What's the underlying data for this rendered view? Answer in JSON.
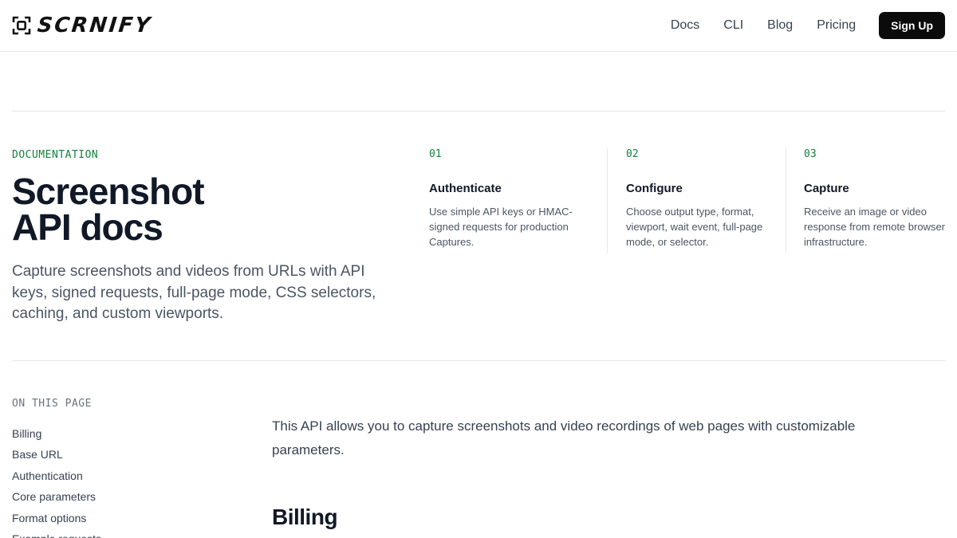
{
  "brand": {
    "name": "SCRNIFY"
  },
  "nav": {
    "links": [
      "Docs",
      "CLI",
      "Blog",
      "Pricing"
    ],
    "cta": "Sign Up"
  },
  "hero": {
    "eyebrow": "DOCUMENTATION",
    "title_line1": "Screenshot",
    "title_line2": "API docs",
    "description": "Capture screenshots and videos from URLs with API keys, signed requests, full-page mode, CSS selectors, caching, and custom viewports."
  },
  "steps": [
    {
      "number": "01",
      "title": "Authenticate",
      "description": "Use simple API keys or HMAC-signed requests for production Captures."
    },
    {
      "number": "02",
      "title": "Configure",
      "description": "Choose output type, format, viewport, wait event, full-page mode, or selector."
    },
    {
      "number": "03",
      "title": "Capture",
      "description": "Receive an image or video response from remote browser infrastructure."
    }
  ],
  "toc": {
    "label": "ON THIS PAGE",
    "items": [
      "Billing",
      "Base URL",
      "Authentication",
      "Core parameters",
      "Format options",
      "Example requests"
    ]
  },
  "content": {
    "intro": "This API allows you to capture screenshots and video recordings of web pages with customizable parameters.",
    "section_heading": "Billing"
  },
  "colors": {
    "accent": "#15803d",
    "cta_bg": "#0b0b0b",
    "border": "#e5e7eb"
  },
  "icons": {
    "logo": "viewfinder-icon"
  }
}
